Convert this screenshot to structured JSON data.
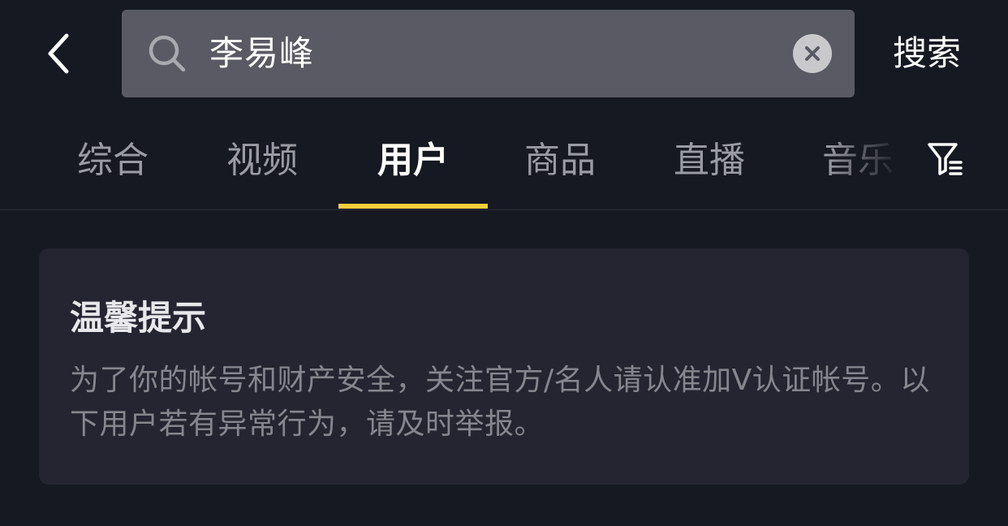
{
  "search": {
    "query": "李易峰",
    "submit_label": "搜索"
  },
  "tabs": [
    {
      "label": "综合",
      "active": false
    },
    {
      "label": "视频",
      "active": false
    },
    {
      "label": "用户",
      "active": true
    },
    {
      "label": "商品",
      "active": false
    },
    {
      "label": "直播",
      "active": false
    },
    {
      "label": "音乐",
      "active": false
    }
  ],
  "tip": {
    "title": "温馨提示",
    "body": "为了你的帐号和财产安全，关注官方/名人请认准加V认证帐号。以下用户若有异常行为，请及时举报。"
  },
  "colors": {
    "background": "#161822",
    "search_box": "#5a5a64",
    "tab_indicator": "#f5cf3b",
    "card": "#242530"
  },
  "icons": {
    "back": "chevron-left-icon",
    "search": "search-icon",
    "clear": "close-circle-icon",
    "filter": "filter-icon"
  }
}
